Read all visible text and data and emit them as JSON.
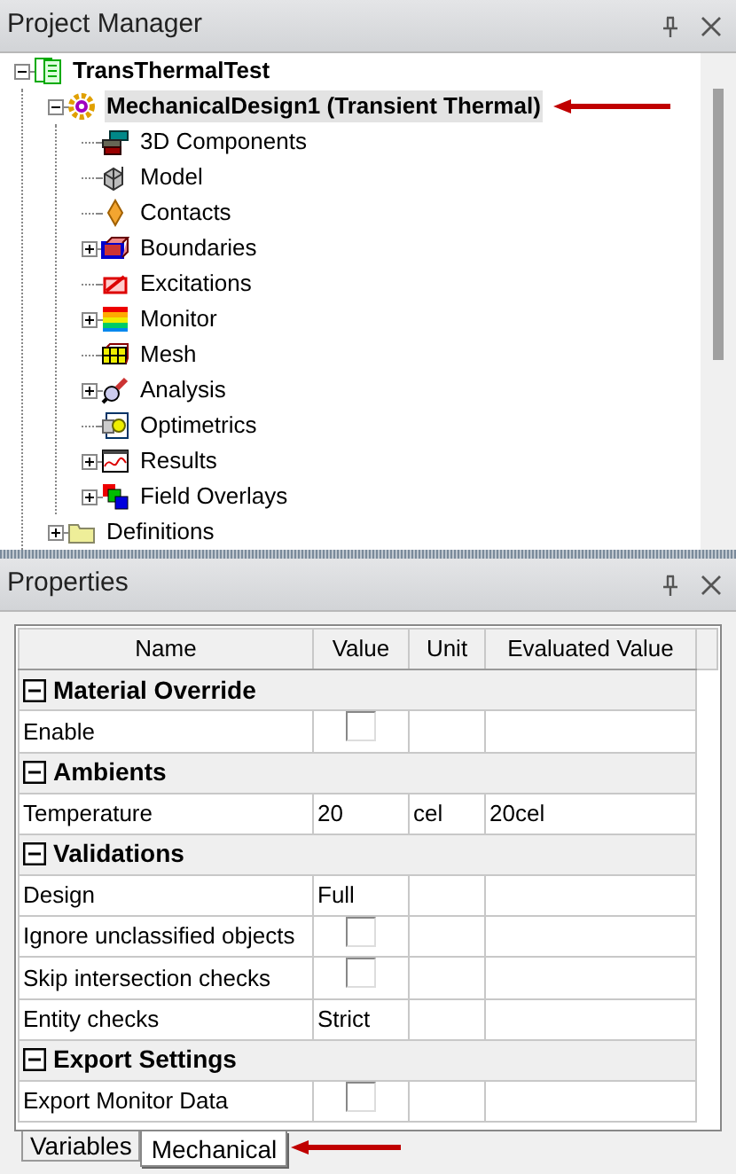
{
  "project_manager": {
    "title": "Project Manager",
    "tree": [
      {
        "label": "TransThermalTest",
        "kind": "project",
        "selected": false,
        "expanded": true,
        "children": [
          {
            "label": "MechanicalDesign1 (Transient Thermal)",
            "kind": "design",
            "selected": true,
            "expanded": true,
            "pointer": true,
            "children": [
              {
                "label": "3D Components",
                "kind": "components",
                "selected": false
              },
              {
                "label": "Model",
                "kind": "model",
                "selected": false
              },
              {
                "label": "Contacts",
                "kind": "contacts",
                "selected": false
              },
              {
                "label": "Boundaries",
                "kind": "boundaries",
                "selected": false,
                "expanded": false
              },
              {
                "label": "Excitations",
                "kind": "excitations",
                "selected": false
              },
              {
                "label": "Monitor",
                "kind": "monitor",
                "selected": false,
                "expanded": false
              },
              {
                "label": "Mesh",
                "kind": "mesh",
                "selected": false
              },
              {
                "label": "Analysis",
                "kind": "analysis",
                "selected": false,
                "expanded": false
              },
              {
                "label": "Optimetrics",
                "kind": "optimetrics",
                "selected": false
              },
              {
                "label": "Results",
                "kind": "results",
                "selected": false,
                "expanded": false
              },
              {
                "label": "Field Overlays",
                "kind": "overlays",
                "selected": false,
                "expanded": false
              }
            ]
          },
          {
            "label": "Definitions",
            "kind": "folder",
            "selected": false,
            "expanded": false
          }
        ]
      }
    ]
  },
  "properties": {
    "title": "Properties",
    "columns": [
      "Name",
      "Value",
      "Unit",
      "Evaluated Value"
    ],
    "rows": [
      {
        "kind": "group",
        "label": "Material Override",
        "expanded": true
      },
      {
        "kind": "checkbox",
        "name": "Enable",
        "checked": false
      },
      {
        "kind": "group",
        "label": "Ambients",
        "expanded": true
      },
      {
        "kind": "text",
        "name": "Temperature",
        "value": "20",
        "unit": "cel",
        "evaluated": "20cel"
      },
      {
        "kind": "group",
        "label": "Validations",
        "expanded": true
      },
      {
        "kind": "text",
        "name": "Design",
        "value": "Full"
      },
      {
        "kind": "checkbox",
        "name": "Ignore unclassified objects",
        "checked": false
      },
      {
        "kind": "checkbox",
        "name": "Skip intersection checks",
        "checked": false
      },
      {
        "kind": "text",
        "name": "Entity checks",
        "value": "Strict"
      },
      {
        "kind": "group",
        "label": "Export Settings",
        "expanded": true
      },
      {
        "kind": "checkbox",
        "name": "Export Monitor Data",
        "checked": false
      }
    ],
    "tabs": [
      {
        "label": "Variables",
        "selected": false
      },
      {
        "label": "Mechanical",
        "selected": true,
        "pointer": true
      }
    ]
  }
}
